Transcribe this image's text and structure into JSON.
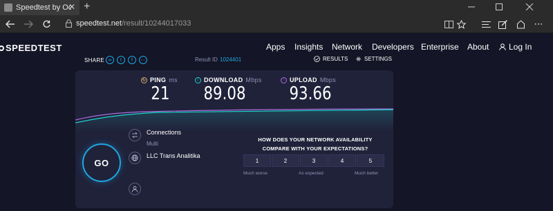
{
  "browser": {
    "tab_title": "Speedtest by Ookla - Th",
    "url_host": "speedtest.net",
    "url_path": "/result/10244017033"
  },
  "site": {
    "logo": "SPEEDTEST",
    "nav": [
      "Apps",
      "Insights",
      "Network",
      "Developers",
      "Enterprise",
      "About"
    ],
    "login": "Log In"
  },
  "share": {
    "label": "SHARE",
    "icons": [
      "link-icon",
      "twitter-icon",
      "facebook-icon",
      "more-icon"
    ]
  },
  "result": {
    "id_label": "Result ID",
    "id_value": "1024401",
    "results_link": "RESULTS",
    "settings_link": "SETTINGS"
  },
  "metrics": {
    "ping": {
      "label": "PING",
      "unit": "ms",
      "value": "21"
    },
    "download": {
      "label": "DOWNLOAD",
      "unit": "Mbps",
      "value": "89.08"
    },
    "upload": {
      "label": "UPLOAD",
      "unit": "Mbps",
      "value": "93.66"
    }
  },
  "colors": {
    "accent": "#1ea7e1",
    "download": "#1ed7d1",
    "upload": "#b06ce0",
    "ping": "#d8b06a"
  },
  "go_button": "GO",
  "connection": {
    "title": "Connections",
    "mode": "Multi",
    "isp": "LLC Trans Analitika"
  },
  "survey": {
    "question": "HOW DOES YOUR NETWORK AVAILABILITY COMPARE WITH YOUR EXPECTATIONS?",
    "options": [
      "1",
      "2",
      "3",
      "4",
      "5"
    ],
    "low_label": "Much worse",
    "mid_label": "As expected",
    "high_label": "Much better"
  }
}
